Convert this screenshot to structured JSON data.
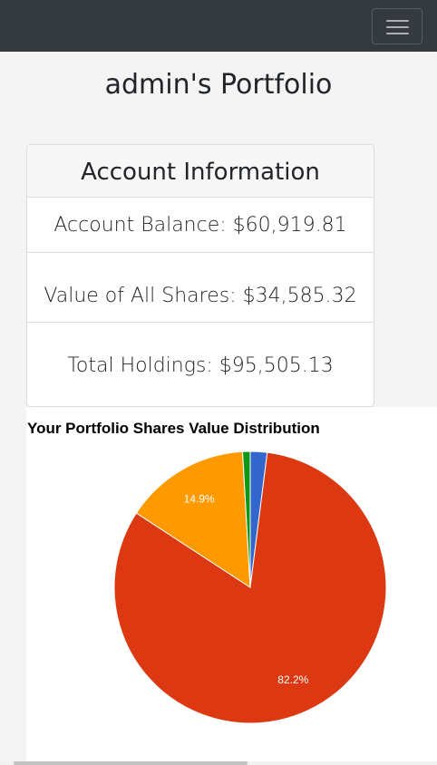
{
  "navbar": {
    "menu_icon": "hamburger-icon"
  },
  "page": {
    "title": "admin's Portfolio"
  },
  "account": {
    "header": "Account Information",
    "balance": "Account Balance: $60,919.81",
    "shares_value": "Value of All Shares: $34,585.32",
    "total_holdings": "Total Holdings: $95,505.13"
  },
  "chart_data": {
    "type": "pie",
    "title": "Your Portfolio Shares Value Distribution",
    "slices": [
      {
        "value": 2.0,
        "color": "#3366cc",
        "label": ""
      },
      {
        "value": 82.2,
        "color": "#dc3912",
        "label": "82.2%"
      },
      {
        "value": 14.9,
        "color": "#ff9900",
        "label": "14.9%"
      },
      {
        "value": 0.9,
        "color": "#109618",
        "label": ""
      }
    ]
  }
}
